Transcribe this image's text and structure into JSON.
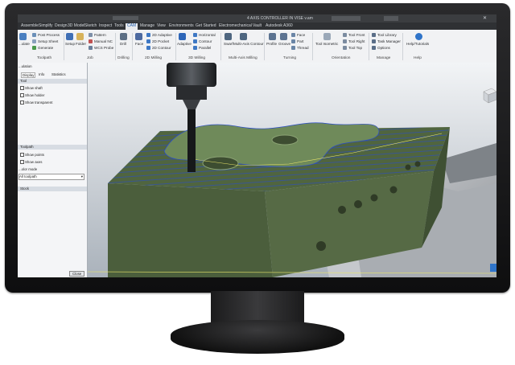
{
  "app": {
    "title": "4 AXIS CONTROLLER IN VISE v.am"
  },
  "tabs": [
    {
      "label": "Assemble"
    },
    {
      "label": "Simplify"
    },
    {
      "label": "Design"
    },
    {
      "label": "3D Model"
    },
    {
      "label": "Sketch"
    },
    {
      "label": "Inspect"
    },
    {
      "label": "Tools"
    },
    {
      "label": "CAM"
    },
    {
      "label": "Manage"
    },
    {
      "label": "View"
    },
    {
      "label": "Environments"
    },
    {
      "label": "Get Started"
    },
    {
      "label": "Electromechanical"
    },
    {
      "label": "Vault"
    },
    {
      "label": "Autodesk A360"
    }
  ],
  "ribbon": {
    "toolpath": {
      "name": "Toolpath",
      "post_process": "Post Process",
      "setup_sheet": "Setup Sheet",
      "generate": "Generate",
      "simulate": "...ulate"
    },
    "job": {
      "name": "Job",
      "setup": "Setup",
      "folder": "Folder",
      "pattern": "Pattern",
      "manual_nc": "Manual NC",
      "wcs_probe": "WCS Probe"
    },
    "drilling": {
      "name": "Drilling",
      "drill": "Drill"
    },
    "milling2d": {
      "name": "2D Milling",
      "face": "Face",
      "adaptive": "2D Adaptive",
      "pocket": "2D Pocket",
      "contour": "2D Contour"
    },
    "milling3d": {
      "name": "3D Milling",
      "adaptive": "Adaptive",
      "horizontal": "Horizontal",
      "contour": "Contour",
      "parallel": "Parallel"
    },
    "multiaxis": {
      "name": "Multi-Axis Milling",
      "swarf": "Swarf",
      "multi_axis_contour": "Multi-Axis Contour"
    },
    "turning": {
      "name": "Turning",
      "profile": "Profile",
      "groove": "Groove",
      "face": "Face",
      "part": "Part",
      "thread": "Thread"
    },
    "orientation": {
      "name": "Orientation",
      "tool_isometric": "Tool Isometric",
      "tool_front": "Tool Front",
      "tool_right": "Tool Right",
      "tool_top": "Tool Top"
    },
    "manage": {
      "name": "Manage",
      "tool_library": "Tool Library",
      "task_manager": "Task Manager",
      "options": "Options"
    },
    "help": {
      "name": "Help",
      "help_tutorials": "Help/Tutorials"
    }
  },
  "panel": {
    "header": "...ulation",
    "tabs": [
      "Display",
      "Info",
      "Statistics"
    ],
    "tool_section": "Tool",
    "show_shaft": "Show shaft",
    "show_holder": "Show holder",
    "show_transparent": "Show transparent",
    "toolpath_section": "Toolpath",
    "show_points": "Show points",
    "show_axes": "Show axes",
    "color_mode": "...olor mode",
    "toolpath_select": "All toolpath",
    "stock_section": "Stock",
    "close": "Close"
  },
  "colors": {
    "part_top": "#566b46",
    "part_side": "#4a5e3c",
    "toolpath": "#2a4cc8",
    "accent_tab": "#1e5aa8"
  }
}
